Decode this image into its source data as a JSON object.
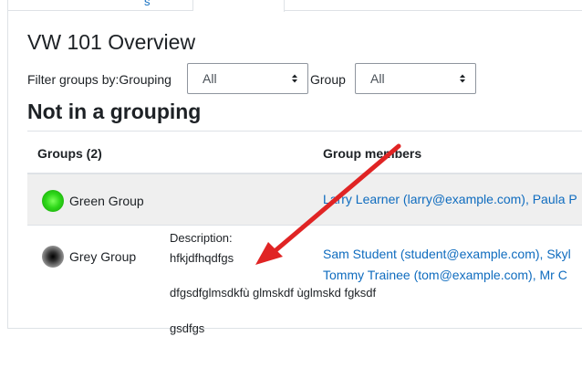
{
  "tabs": {
    "previous_tab_label": "s",
    "active_tab_label": ""
  },
  "page": {
    "title": "VW 101 Overview"
  },
  "filters": {
    "grouping_label": "Filter groups by:Grouping",
    "grouping_value": "All",
    "group_label": "Group",
    "group_value": "All"
  },
  "section": {
    "title": "Not in a grouping"
  },
  "table": {
    "headers": [
      "Groups (2)",
      "Group members"
    ],
    "rows": [
      {
        "group_name": "Green Group",
        "members_line1": "Larry Learner (larry@example.com), Paula P",
        "members_line2": ""
      },
      {
        "group_name": "Grey Group",
        "description_label": "Description:",
        "description_line1": "hfkjdfhqdfgs",
        "description_line2": "dfgsdfglmsdkfù glmskdf ùglmskd fgksdf",
        "description_line3": "gsdfgs",
        "members_line1": "Sam Student (student@example.com), Skyl",
        "members_line2": "Tommy Trainee (tom@example.com), Mr C"
      }
    ]
  },
  "colors": {
    "link": "#0f6cbf",
    "arrow": "#e02424",
    "row_highlight": "#efefef"
  }
}
